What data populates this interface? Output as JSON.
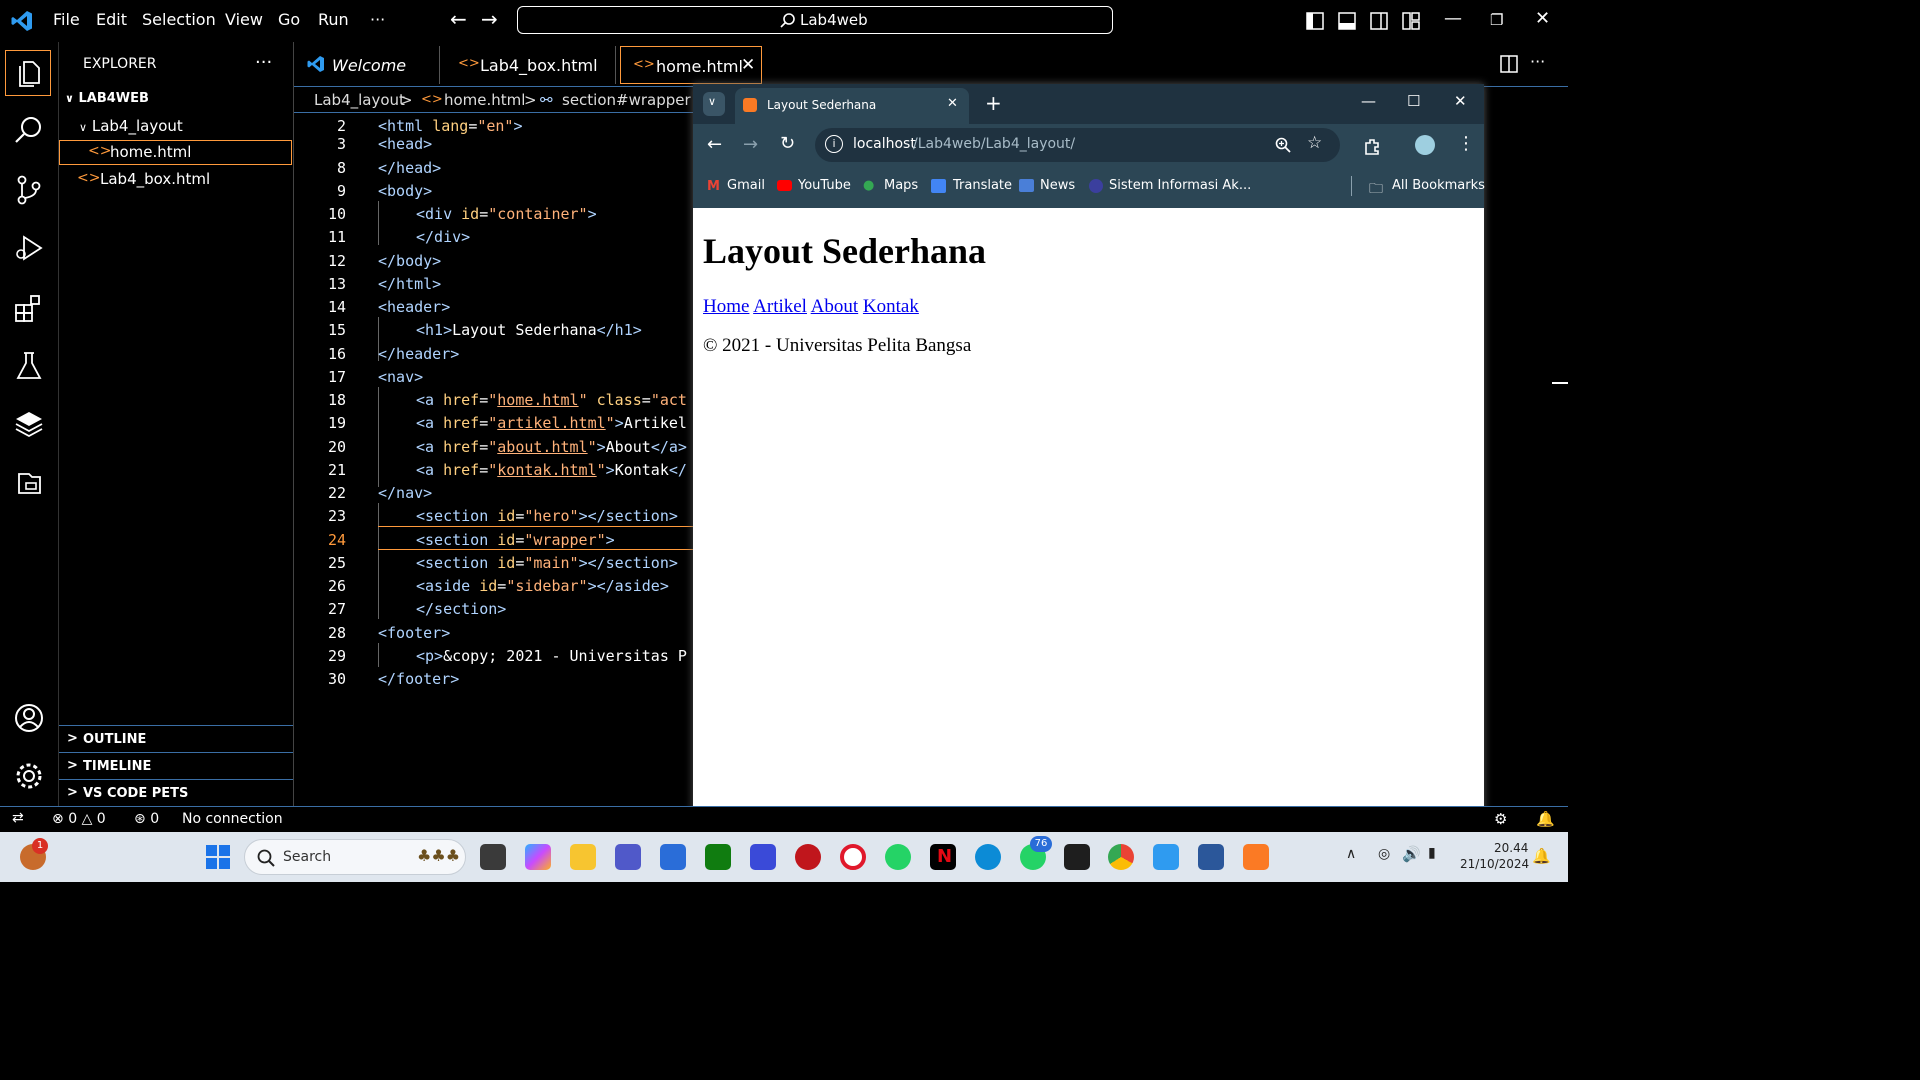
{
  "menu": [
    "File",
    "Edit",
    "Selection",
    "View",
    "Go",
    "Run",
    "···"
  ],
  "command_center": "Lab4web",
  "explorer": {
    "title": "EXPLORER",
    "more": "···",
    "root": "LAB4WEB",
    "folder": "Lab4_layout",
    "files": [
      "home.html",
      "Lab4_box.html"
    ],
    "sections": [
      "OUTLINE",
      "TIMELINE",
      "VS CODE PETS"
    ]
  },
  "tabs": [
    {
      "label": "Welcome"
    },
    {
      "label": "Lab4_box.html"
    },
    {
      "label": "home.html"
    }
  ],
  "breadcrumb": [
    "Lab4_layout",
    "home.html",
    "section#wrapper"
  ],
  "editor": {
    "line_numbers": [
      "2",
      "3",
      "8",
      "9",
      "10",
      "11",
      "12",
      "13",
      "14",
      "15",
      "16",
      "17",
      "18",
      "19",
      "20",
      "21",
      "22",
      "23",
      "24",
      "25",
      "26",
      "27",
      "28",
      "29",
      "30"
    ],
    "active_line": "24"
  },
  "browser": {
    "tab_title": "Layout Sederhana",
    "url_host": "localhost",
    "url_path": "/Lab4web/Lab4_layout/",
    "bookmarks": [
      "Gmail",
      "YouTube",
      "Maps",
      "Translate",
      "News",
      "Sistem Informasi Ak..."
    ],
    "all_bookmarks": "All Bookmarks",
    "page": {
      "heading": "Layout Sederhana",
      "nav": [
        "Home",
        "Artikel",
        "About",
        "Kontak"
      ],
      "footer": "© 2021 - Universitas Pelita Bangsa"
    }
  },
  "status": {
    "errors": "0",
    "warnings": "0",
    "ports": "0",
    "connection": "No connection"
  },
  "taskbar": {
    "search": "Search",
    "notification_badge": "1",
    "whatsapp_badge": "76",
    "time": "20.44",
    "date": "21/10/2024"
  }
}
